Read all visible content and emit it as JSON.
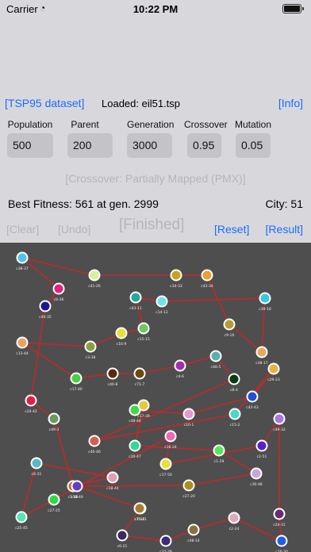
{
  "status_bar": {
    "carrier": "Carrier",
    "time": "10:22 PM"
  },
  "header": {
    "dataset_button": "[TSP95 dataset]",
    "loaded_text": "Loaded: eil51.tsp",
    "info_button": "[Info]"
  },
  "params": {
    "population": {
      "label": "Population",
      "value": "500"
    },
    "parent": {
      "label": "Parent",
      "value": "200"
    },
    "generation": {
      "label": "Generation",
      "value": "3000"
    },
    "crossover": {
      "label": "Crossover",
      "value": "0.95"
    },
    "mutation": {
      "label": "Mutation",
      "value": "0.05"
    }
  },
  "crossover_method": "[Crossover: Partially Mapped (PMX)]",
  "best_fitness": "Best Fitness: 561 at gen. 2999",
  "city_count": "City: 51",
  "controls": {
    "clear": "[Clear]",
    "undo": "[Undo]",
    "status": "[Finished]",
    "reset": "[Reset]",
    "result": "[Result]"
  },
  "colors": {
    "accent": "#1a6cff",
    "disabled": "#b5b5ba",
    "canvas": "#4e4e4e",
    "route": "#c0282a"
  },
  "map": {
    "cities": [
      {
        "label": "c38-37",
        "color": "#4fc3e8"
      },
      {
        "label": "c8-36",
        "color": "#e2227d"
      },
      {
        "label": "c40-35",
        "color": "#1c1894"
      },
      {
        "label": "c41-26",
        "color": "#d6f29a"
      },
      {
        "label": "c34-33",
        "color": "#c9a020"
      },
      {
        "label": "c43-34",
        "color": "#e8a030"
      },
      {
        "label": "c43-11",
        "color": "#26a89a"
      },
      {
        "label": "c14-12",
        "color": "#6ee0f0"
      },
      {
        "label": "c39-10",
        "color": "#38c8e0"
      },
      {
        "label": "c13-44",
        "color": "#f0a060"
      },
      {
        "label": "c3-38",
        "color": "#8aa040"
      },
      {
        "label": "c16-9",
        "color": "#e8e038"
      },
      {
        "label": "c15-15",
        "color": "#6cc860"
      },
      {
        "label": "c9-16",
        "color": "#b89a30"
      },
      {
        "label": "c38-17",
        "color": "#e8a860"
      },
      {
        "label": "c17-40",
        "color": "#48d040"
      },
      {
        "label": "c46-8",
        "color": "#5a2a10"
      },
      {
        "label": "c71-7",
        "color": "#6a4a10"
      },
      {
        "label": "c4-6",
        "color": "#a030b0"
      },
      {
        "label": "c48-5",
        "color": "#5ab0b0"
      },
      {
        "label": "c8-4",
        "color": "#0a3a10"
      },
      {
        "label": "c29-23",
        "color": "#e8b040"
      },
      {
        "label": "c24-42",
        "color": "#e0204a"
      },
      {
        "label": "c49-3",
        "color": "#6a9a60"
      },
      {
        "label": "c43-43",
        "color": "#2050d8"
      },
      {
        "label": "c48-44",
        "color": "#40d848"
      },
      {
        "label": "c17-39",
        "color": "#e8c838"
      },
      {
        "label": "c16-24",
        "color": "#f068b0"
      },
      {
        "label": "c10-1",
        "color": "#e898d0"
      },
      {
        "label": "c15-2",
        "color": "#48d8c8"
      },
      {
        "label": "c49-32",
        "color": "#a878e0"
      },
      {
        "label": "c40-46",
        "color": "#d06050"
      },
      {
        "label": "c20-47",
        "color": "#30d898"
      },
      {
        "label": "c17-50",
        "color": "#e8e038"
      },
      {
        "label": "c2-51",
        "color": "#5a20c8"
      },
      {
        "label": "c1-29",
        "color": "#50e858"
      },
      {
        "label": "c6-31",
        "color": "#58b8c8"
      },
      {
        "label": "c18-44",
        "color": "#e0a0b0"
      },
      {
        "label": "c5-18",
        "color": "#c86040"
      },
      {
        "label": "c27-20",
        "color": "#a89020"
      },
      {
        "label": "c30-48",
        "color": "#c8a8d8"
      },
      {
        "label": "c10-49",
        "color": "#6040c0"
      },
      {
        "label": "c15-41",
        "color": "#9a9a30"
      },
      {
        "label": "c25-45",
        "color": "#50e8b0"
      },
      {
        "label": "c6-21",
        "color": "#3a2a60"
      },
      {
        "label": "c7-22",
        "color": "#a08030"
      },
      {
        "label": "c48-14",
        "color": "#8a7040"
      },
      {
        "label": "c37-28",
        "color": "#3a2a80"
      },
      {
        "label": "c2-24",
        "color": "#e0a8b8"
      },
      {
        "label": "c24-31",
        "color": "#6a2a70"
      },
      {
        "label": "c27-25",
        "color": "#30d848"
      },
      {
        "label": "c16-30",
        "color": "#2060e8"
      }
    ]
  }
}
